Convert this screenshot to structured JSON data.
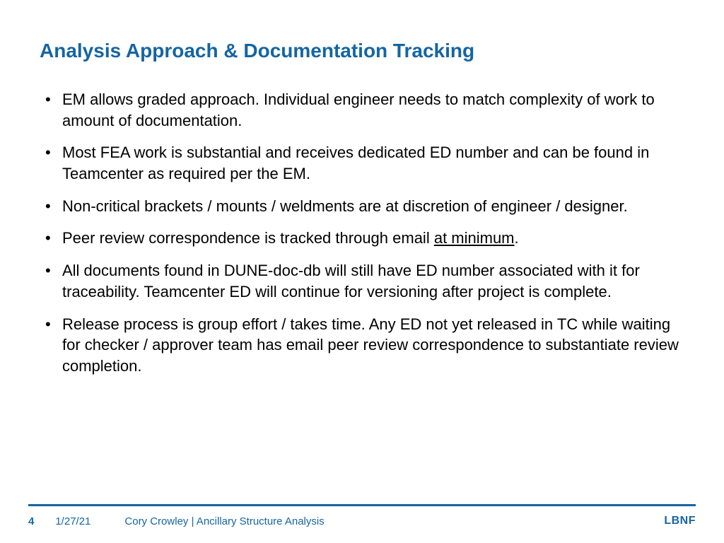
{
  "title": "Analysis Approach & Documentation Tracking",
  "bullets": [
    {
      "pre": "EM allows graded approach. Individual engineer needs to match complexity of work to amount of documentation.",
      "underline": "",
      "post": ""
    },
    {
      "pre": "Most FEA work is substantial and receives dedicated ED number and can be found in Teamcenter as required per the EM.",
      "underline": "",
      "post": ""
    },
    {
      "pre": "Non-critical brackets / mounts / weldments are at discretion of engineer / designer.",
      "underline": "",
      "post": ""
    },
    {
      "pre": "Peer review correspondence is tracked through email ",
      "underline": "at minimum",
      "post": "."
    },
    {
      "pre": "All documents found in DUNE-doc-db will still have ED number associated with it for traceability. Teamcenter ED will continue for versioning after project is complete.",
      "underline": "",
      "post": ""
    },
    {
      "pre": "Release process is group effort / takes time. Any ED not yet released in TC while waiting for checker / approver team has email peer review correspondence to substantiate review completion.",
      "underline": "",
      "post": ""
    }
  ],
  "footer": {
    "page": "4",
    "date": "1/27/21",
    "author": "Cory Crowley | Ancillary Structure Analysis",
    "logo": "LBNF"
  }
}
